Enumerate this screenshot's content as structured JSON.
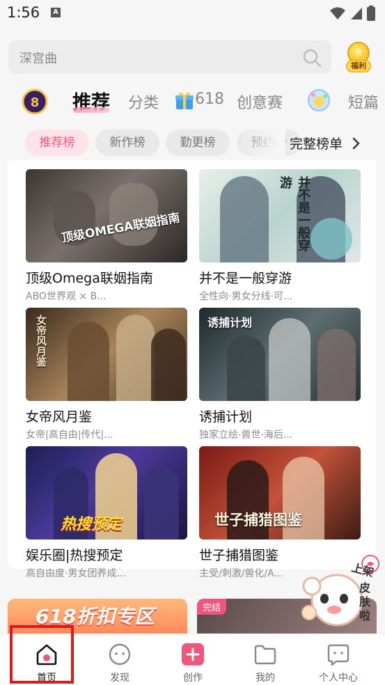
{
  "status_bar": {
    "time": "1:56",
    "a_label": "A"
  },
  "search": {
    "placeholder": "深宫曲"
  },
  "welfare": {
    "label": "福利"
  },
  "nav_tabs": {
    "recommend": "推荐",
    "category": "分类",
    "promo": "618",
    "contest": "创意赛",
    "short": "短篇"
  },
  "chips": {
    "recommend_rank": "推荐榜",
    "new_rank": "新作榜",
    "update_rank": "勤更榜",
    "reserve_rank": "预约榜",
    "full_rank": "完整榜单"
  },
  "books": [
    {
      "title": "顶级Omega联姻指南",
      "tags": "ABO世界观 × B...",
      "cover_text": "顶级OMEGA联姻指南"
    },
    {
      "title": "并不是一般穿游",
      "tags": "全性向·男女分线·可...",
      "cover_text": "并不是一般穿游"
    },
    {
      "title": "女帝风月鉴",
      "tags": "女帝|高自由|传代|...",
      "cover_text": "女帝风月鉴"
    },
    {
      "title": "诱捕计划",
      "tags": "独家立绘·兽世·海后...",
      "cover_text": "诱捕计划"
    },
    {
      "title": "娱乐圈|热搜预定",
      "tags": "高自由度·男女团养成...",
      "cover_text": "热搜预定"
    },
    {
      "title": "世子捕猎图鉴",
      "tags": "主受/刺激/兽化/A...",
      "cover_text": "世子捕猎图鉴"
    }
  ],
  "banners": {
    "left_text": "618折扣专区",
    "right_badge": "完结"
  },
  "sticker": {
    "text": "我上架皮肤啦"
  },
  "tabbar": {
    "home": "首页",
    "discover": "发现",
    "create": "创作",
    "mine": "我的",
    "profile": "个人中心"
  },
  "colors": {
    "accent": "#f0567d",
    "highlight": "#e01818"
  }
}
